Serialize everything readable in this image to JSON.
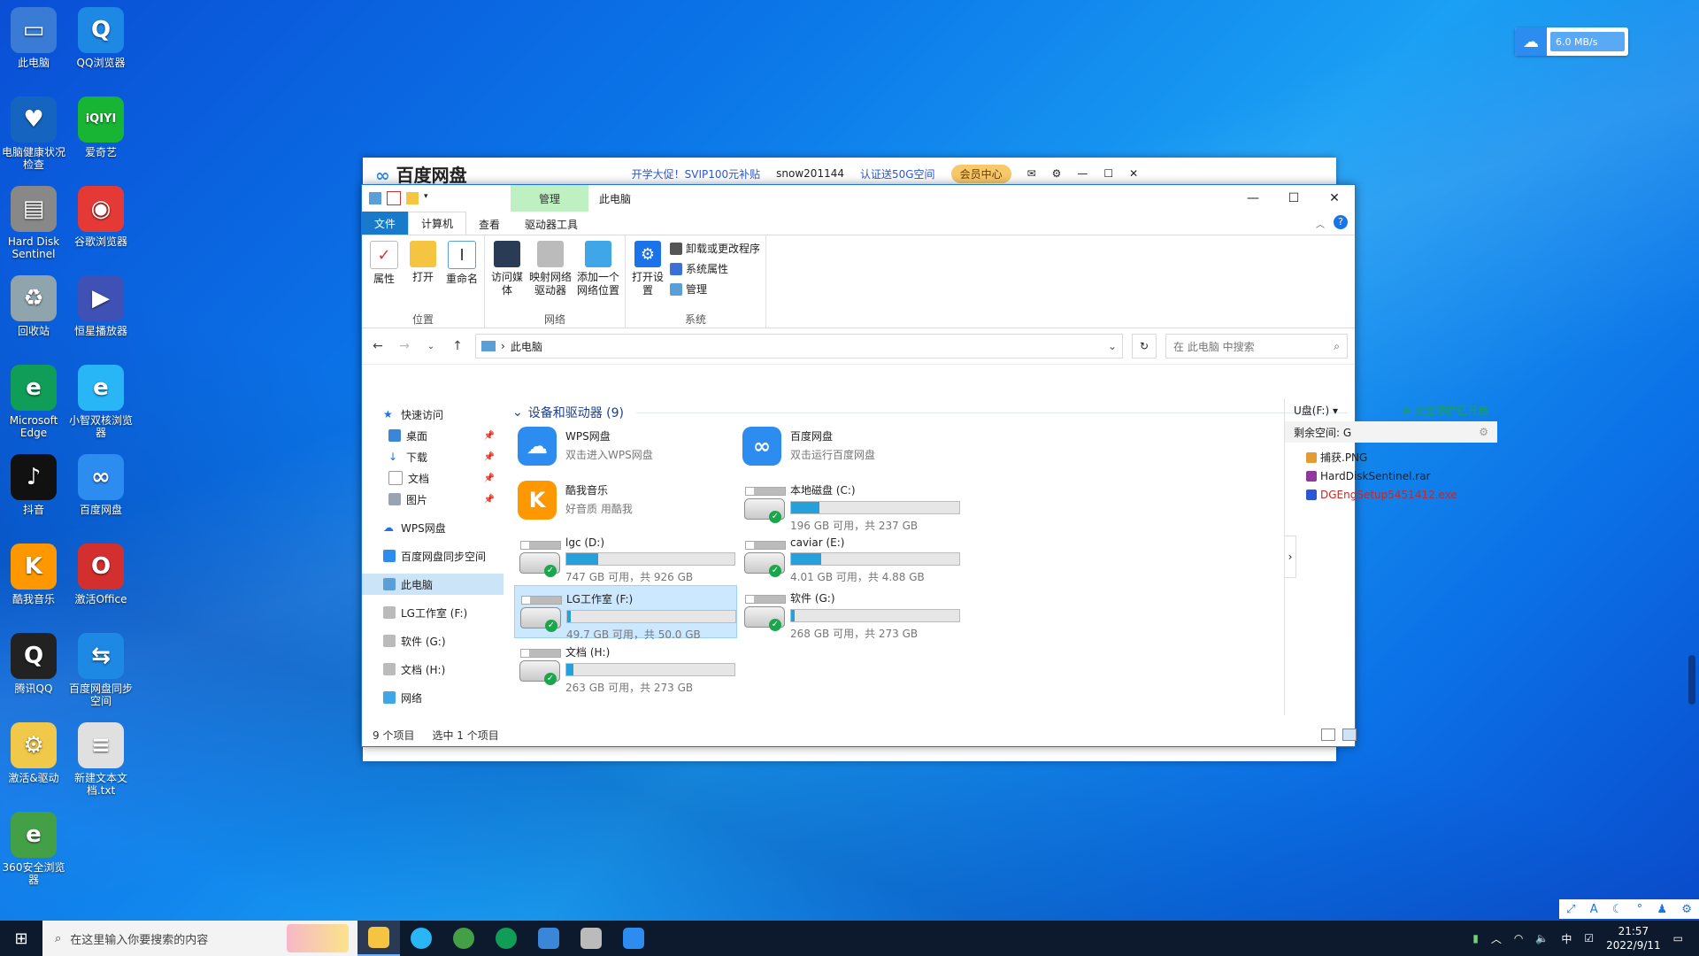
{
  "desktop": {
    "icons": [
      {
        "label": "此电脑",
        "glyph": "▭",
        "color": "#3a7bd5"
      },
      {
        "label": "QQ浏览器",
        "glyph": "Q",
        "color": "#1e88e5"
      },
      {
        "label": "电脑健康状况检查",
        "glyph": "♥",
        "color": "#1565c0"
      },
      {
        "label": "爱奇艺",
        "glyph": "iQIYI",
        "color": "#18b534"
      },
      {
        "label": "Hard Disk Sentinel",
        "glyph": "▤",
        "color": "#888888"
      },
      {
        "label": "谷歌浏览器",
        "glyph": "◉",
        "color": "#e53935"
      },
      {
        "label": "回收站",
        "glyph": "♻",
        "color": "#90a4ae"
      },
      {
        "label": "恒星播放器",
        "glyph": "▶",
        "color": "#3f51b5"
      },
      {
        "label": "Microsoft Edge",
        "glyph": "e",
        "color": "#0f9d58"
      },
      {
        "label": "小智双核浏览器",
        "glyph": "e",
        "color": "#29b6f6"
      },
      {
        "label": "抖音",
        "glyph": "♪",
        "color": "#111111"
      },
      {
        "label": "百度网盘",
        "glyph": "∞",
        "color": "#2d8cf0"
      },
      {
        "label": "酷我音乐",
        "glyph": "K",
        "color": "#ff9800"
      },
      {
        "label": "激活Office",
        "glyph": "O",
        "color": "#d32f2f"
      },
      {
        "label": "腾讯QQ",
        "glyph": "Q",
        "color": "#222222"
      },
      {
        "label": "百度网盘同步空间",
        "glyph": "⇆",
        "color": "#1e88e5"
      },
      {
        "label": "激活&驱动",
        "glyph": "⚙",
        "color": "#f0c94a"
      },
      {
        "label": "新建文本文档.txt",
        "glyph": "≡",
        "color": "#e0e0e0"
      },
      {
        "label": "360安全浏览器",
        "glyph": "e",
        "color": "#43a047"
      }
    ]
  },
  "net_widget": {
    "speed": "6.0 MB/s"
  },
  "baidu_window": {
    "logo": "百度网盘",
    "promo": "开学大促！SVIP100元补贴",
    "user": "snow201144",
    "verify": "认证送50G空间",
    "vip": "会员中心"
  },
  "explorer": {
    "context_tab": "管理",
    "title": "此电脑",
    "tabs": {
      "file": "文件",
      "computer": "计算机",
      "view": "查看",
      "drive_tools": "驱动器工具"
    },
    "ribbon": {
      "location": {
        "name": "位置",
        "properties": "属性",
        "open": "打开",
        "rename": "重命名"
      },
      "network": {
        "name": "网络",
        "access_media": "访问媒体",
        "map_drive": "映射网络驱动器",
        "add_location": "添加一个网络位置"
      },
      "system": {
        "name": "系统",
        "open_settings": "打开设置",
        "uninstall": "卸载或更改程序",
        "sys_props": "系统属性",
        "manage": "管理"
      }
    },
    "address": {
      "path": "此电脑",
      "search_placeholder": "在 此电脑 中搜索"
    },
    "nav": {
      "quick_access": "快速访问",
      "desktop": "桌面",
      "downloads": "下载",
      "documents": "文档",
      "pictures": "图片",
      "wps": "WPS网盘",
      "baidu_sync": "百度网盘同步空间",
      "this_pc": "此电脑",
      "lg": "LG工作室 (F:)",
      "soft": "软件 (G:)",
      "docs": "文档 (H:)",
      "network": "网络"
    },
    "group_header": "设备和驱动器 (9)",
    "tiles": [
      {
        "name": "WPS网盘",
        "sub": "双击进入WPS网盘",
        "kind": "app",
        "color": "#2d8cf0",
        "glyph": "☁"
      },
      {
        "name": "百度网盘",
        "sub": "双击运行百度网盘",
        "kind": "app",
        "color": "#2d8cf0",
        "glyph": "∞"
      },
      {
        "name": "酷我音乐",
        "sub": "好音质 用酷我",
        "kind": "app",
        "color": "#ff9800",
        "glyph": "K"
      },
      {
        "name": "本地磁盘 (C:)",
        "sub": "196 GB 可用，共 237 GB",
        "kind": "drive",
        "usage": 0.17
      },
      {
        "name": "lgc (D:)",
        "sub": "747 GB 可用，共 926 GB",
        "kind": "drive",
        "usage": 0.19
      },
      {
        "name": "caviar (E:)",
        "sub": "4.01 GB 可用，共 4.88 GB",
        "kind": "drive",
        "usage": 0.18
      },
      {
        "name": "LG工作室 (F:)",
        "sub": "49.7 GB 可用，共 50.0 GB",
        "kind": "drive",
        "usage": 0.01,
        "selected": true
      },
      {
        "name": "软件 (G:)",
        "sub": "268 GB 可用，共 273 GB",
        "kind": "drive",
        "usage": 0.02
      },
      {
        "name": "文档 (H:)",
        "sub": "263 GB 可用，共 273 GB",
        "kind": "drive",
        "usage": 0.04
      }
    ],
    "side_panel": {
      "drive": "U盘(F:)",
      "safe": "安全防护已开启",
      "free": "剩余空间: G",
      "files": [
        "捕获.PNG",
        "HardDiskSentinel.rar",
        "DGEngSetup5451412.exe"
      ]
    },
    "status": {
      "count": "9 个项目",
      "selected": "选中 1 个项目"
    }
  },
  "taskbar": {
    "search_placeholder": "在这里输入你要搜索的内容",
    "ime": "中",
    "time": "21:57",
    "date": "2022/9/11"
  }
}
